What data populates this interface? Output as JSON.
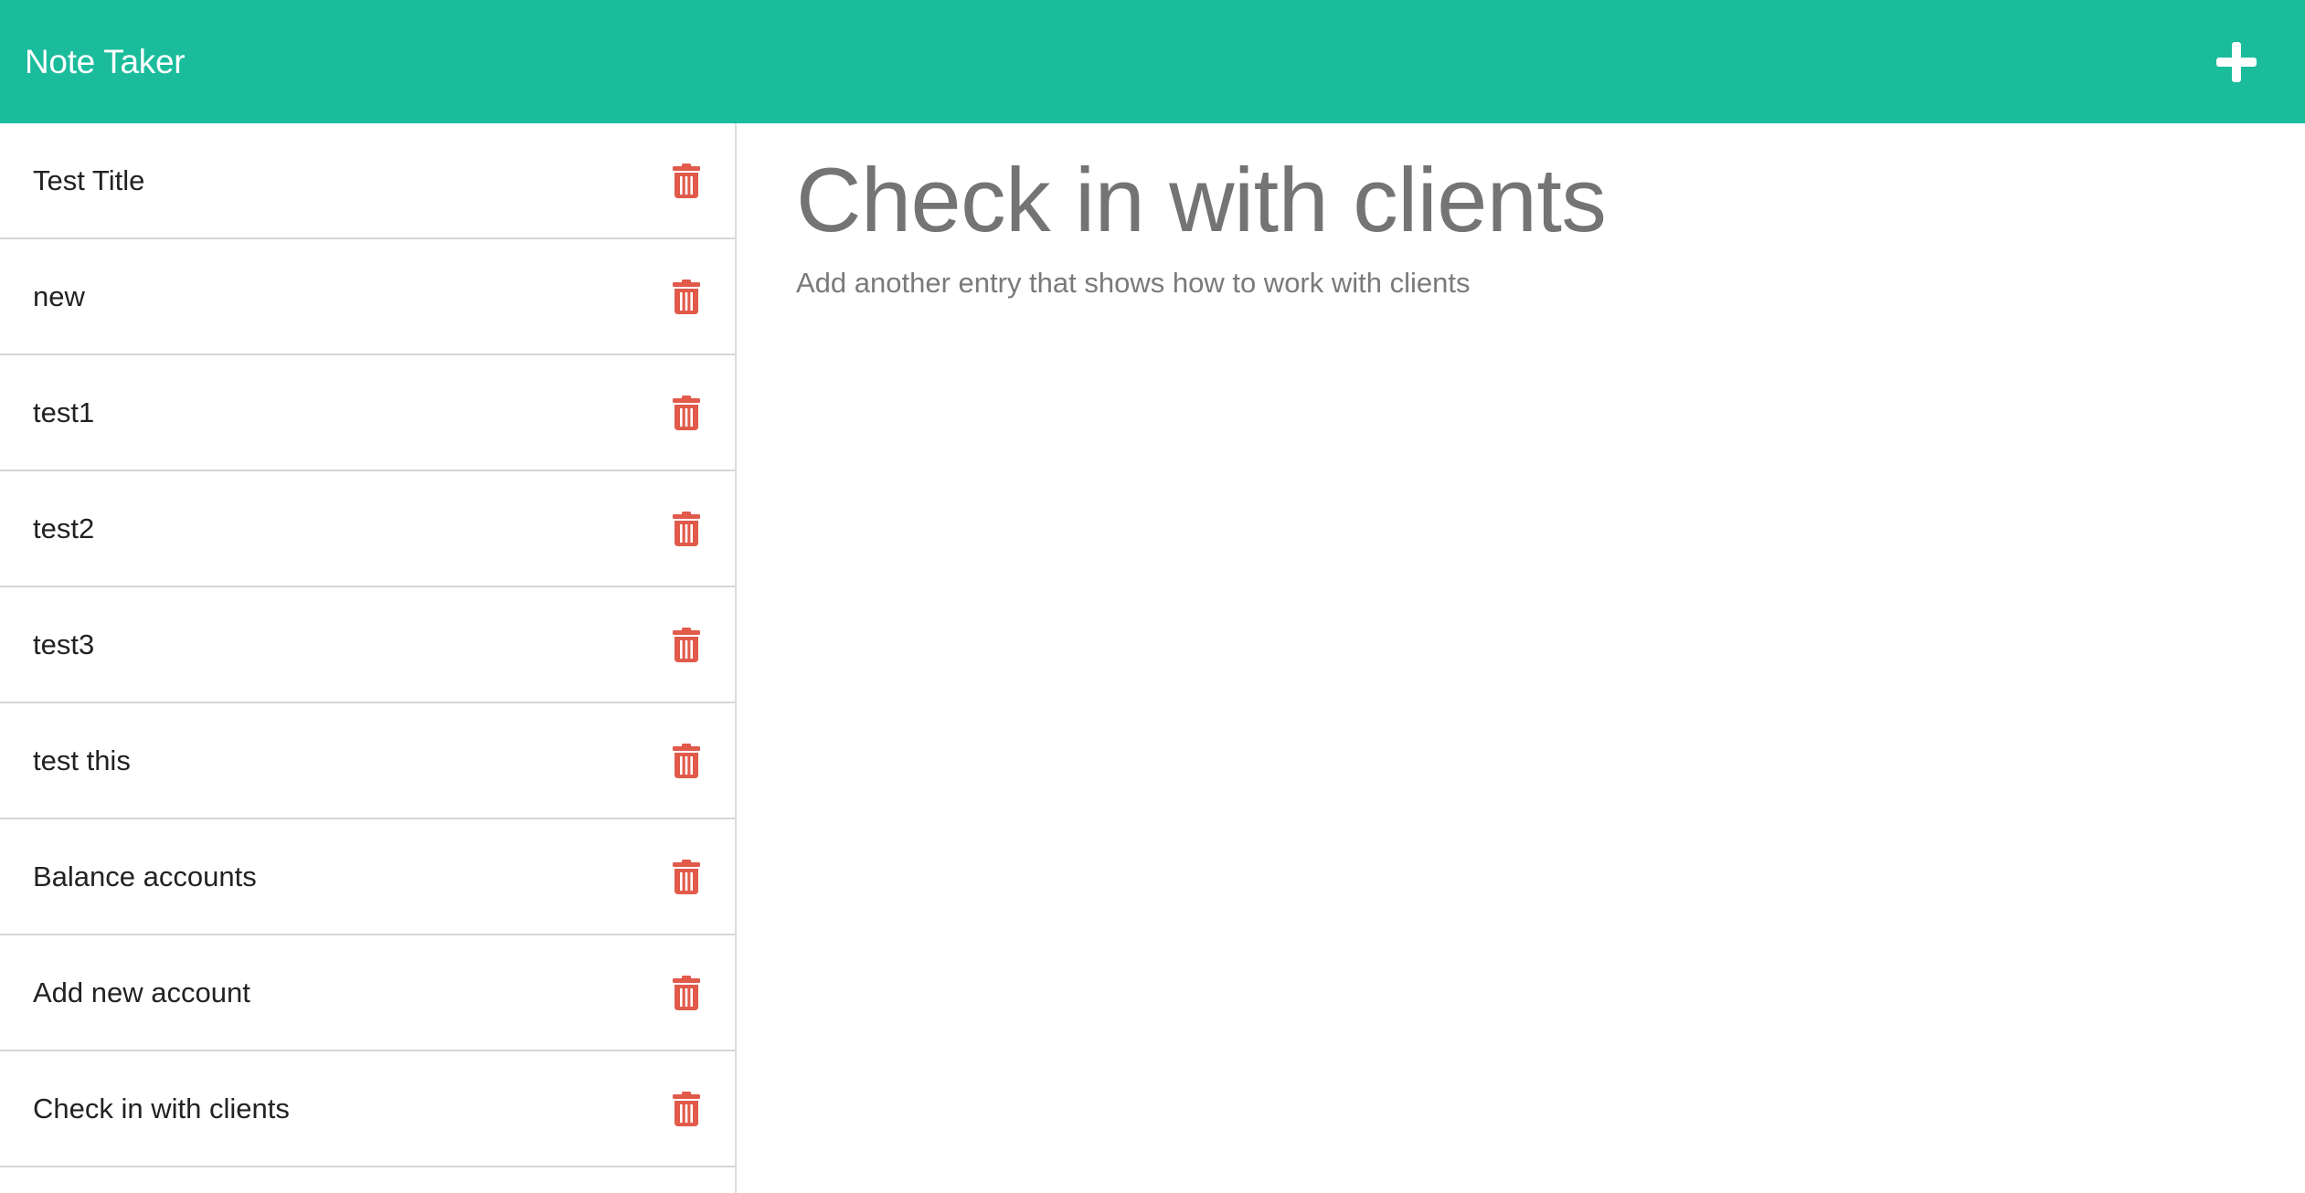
{
  "colors": {
    "navbar_bg": "#1abc9c",
    "navbar_text": "#ffffff",
    "trash_icon": "#e15a4a",
    "note_text": "#222222",
    "active_text": "#747474",
    "body_text": "#7a7a7a"
  },
  "navbar": {
    "brand": "Note Taker",
    "new_note_icon": "plus-icon"
  },
  "notes": [
    {
      "title": "Test Title",
      "delete_icon": "trash-icon"
    },
    {
      "title": "new",
      "delete_icon": "trash-icon"
    },
    {
      "title": "test1",
      "delete_icon": "trash-icon"
    },
    {
      "title": "test2",
      "delete_icon": "trash-icon"
    },
    {
      "title": "test3",
      "delete_icon": "trash-icon"
    },
    {
      "title": "test this",
      "delete_icon": "trash-icon"
    },
    {
      "title": "Balance accounts",
      "delete_icon": "trash-icon"
    },
    {
      "title": "Add new account",
      "delete_icon": "trash-icon"
    },
    {
      "title": "Check in with clients",
      "delete_icon": "trash-icon"
    }
  ],
  "active_note": {
    "title": "Check in with clients",
    "text": "Add another entry that shows how to work with clients"
  }
}
